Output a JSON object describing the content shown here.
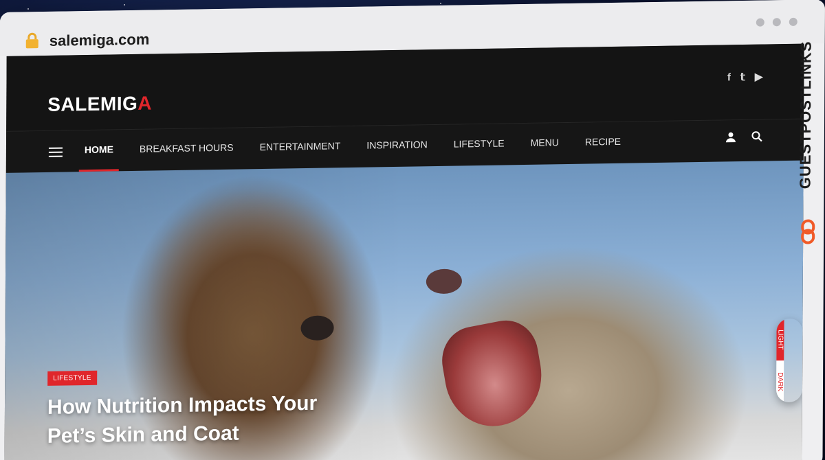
{
  "browser": {
    "url": "salemiga.com"
  },
  "site": {
    "logo_main": "SALEMIG",
    "logo_accent": "A",
    "social": [
      "f",
      "𝕥",
      "▶"
    ],
    "nav": [
      {
        "label": "HOME",
        "active": true
      },
      {
        "label": "BREAKFAST HOURS",
        "active": false
      },
      {
        "label": "ENTERTAINMENT",
        "active": false
      },
      {
        "label": "INSPIRATION",
        "active": false
      },
      {
        "label": "LIFESTYLE",
        "active": false
      },
      {
        "label": "MENU",
        "active": false
      },
      {
        "label": "RECIPE",
        "active": false
      }
    ]
  },
  "hero": {
    "category": "LIFESTYLE",
    "title": "How Nutrition Impacts Your Pet’s Skin and Coat"
  },
  "theme_toggle": {
    "light": "LIGHT",
    "dark": "DARK"
  },
  "watermark": {
    "text": "GUESTPOSTLINKS"
  },
  "colors": {
    "accent": "#e0262b",
    "header_bg": "#141414"
  }
}
